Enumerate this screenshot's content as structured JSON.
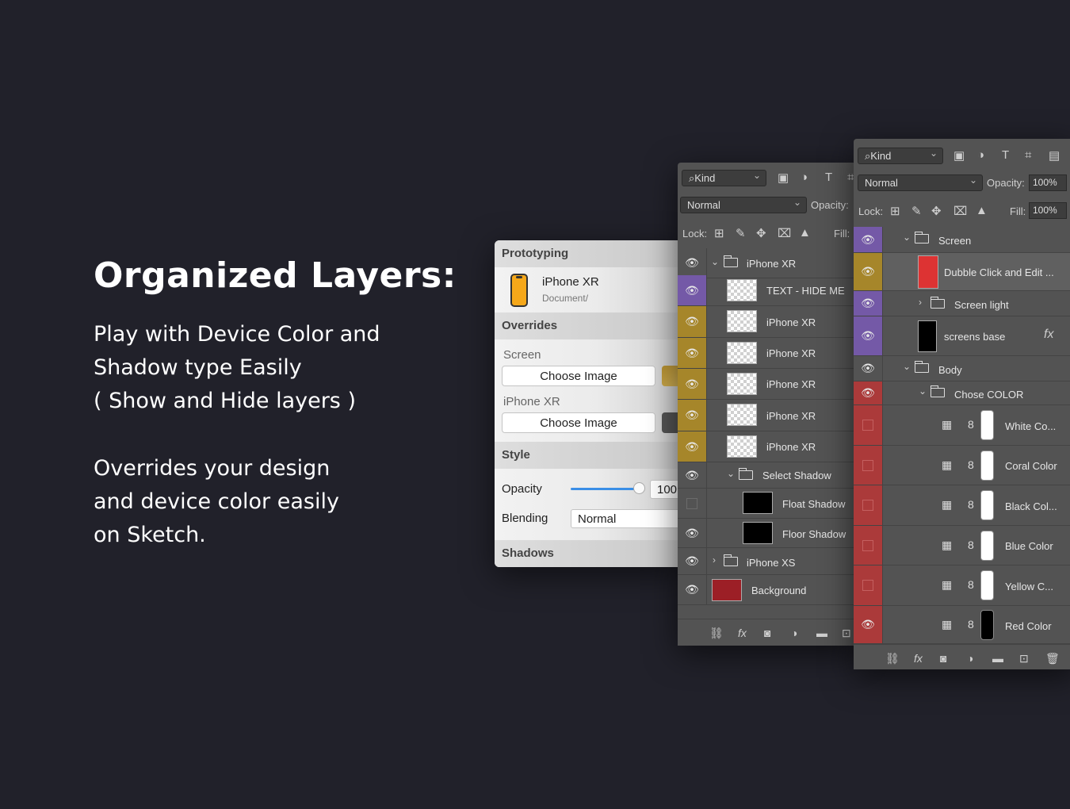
{
  "headline": "Organized Layers:",
  "paragraph1": [
    "Play with Device Color and",
    "Shadow type Easily",
    "( Show and Hide layers )"
  ],
  "paragraph2": [
    "Overrides your design",
    "and device color easily",
    "on Sketch."
  ],
  "sketch_panel": {
    "section_prototyping": "Prototyping",
    "symbol_name": "iPhone XR",
    "symbol_path": "Document/",
    "section_overrides": "Overrides",
    "screen_label": "Screen",
    "screen_button": "Choose Image",
    "iphone_label": "iPhone XR",
    "iphone_button": "Choose Image",
    "section_style": "Style",
    "opacity_label": "Opacity",
    "opacity_value": "100",
    "opacity_fraction": 1.0,
    "blending_label": "Blending",
    "blending_value": "Normal",
    "section_shadows": "Shadows",
    "colors": {
      "phone": "#f6a81a",
      "slider": "#3a8ee6"
    }
  },
  "ps_panel_1": {
    "kind_label": "Kind",
    "blend_mode": "Normal",
    "opacity_label": "Opacity:",
    "lock_label": "Lock:",
    "fill_label": "Fill:",
    "layers": [
      {
        "name": "iPhone XR",
        "type": "group",
        "expanded": true,
        "eye": "visible",
        "color": "none"
      },
      {
        "name": "TEXT - HIDE ME",
        "type": "layer",
        "eye": "visible",
        "color": "purple"
      },
      {
        "name": "iPhone XR",
        "type": "layer",
        "eye": "visible",
        "color": "gold"
      },
      {
        "name": "iPhone XR",
        "type": "layer",
        "eye": "visible",
        "color": "gold"
      },
      {
        "name": "iPhone XR",
        "type": "layer",
        "eye": "visible",
        "color": "gold"
      },
      {
        "name": "iPhone XR",
        "type": "layer",
        "eye": "visible",
        "color": "gold"
      },
      {
        "name": "iPhone XR",
        "type": "layer",
        "eye": "visible",
        "color": "gold"
      },
      {
        "name": "Select Shadow",
        "type": "group",
        "expanded": true,
        "eye": "visible",
        "color": "none"
      },
      {
        "name": "Float Shadow",
        "type": "layer",
        "eye": "hidden",
        "color": "none"
      },
      {
        "name": "Floor Shadow",
        "type": "layer",
        "eye": "visible",
        "color": "none"
      },
      {
        "name": "iPhone XS",
        "type": "group",
        "expanded": false,
        "eye": "visible",
        "color": "none"
      },
      {
        "name": "Background",
        "type": "layer",
        "eye": "visible",
        "color": "none"
      }
    ]
  },
  "ps_panel_2": {
    "kind_label": "Kind",
    "blend_mode": "Normal",
    "opacity_label": "Opacity:",
    "opacity_value": "100%",
    "lock_label": "Lock:",
    "fill_label": "Fill:",
    "fill_value": "100%",
    "fx_label": "fx",
    "layers": [
      {
        "name": "Screen",
        "type": "group",
        "expanded": true,
        "eye": "visible",
        "color": "purple"
      },
      {
        "name": "Dubble Click and Edit ...",
        "type": "layer",
        "eye": "visible",
        "color": "gold"
      },
      {
        "name": "Screen light",
        "type": "group",
        "expanded": false,
        "eye": "visible",
        "color": "purple"
      },
      {
        "name": "screens base",
        "type": "layer",
        "eye": "visible",
        "color": "purple"
      },
      {
        "name": "Body",
        "type": "group",
        "expanded": true,
        "eye": "visible",
        "color": "none"
      },
      {
        "name": "Chose COLOR",
        "type": "group",
        "expanded": true,
        "eye": "visible",
        "color": "red"
      },
      {
        "name": "White Co...",
        "type": "fill",
        "eye": "hidden",
        "color": "red"
      },
      {
        "name": "Coral Color",
        "type": "fill",
        "eye": "hidden",
        "color": "red"
      },
      {
        "name": "Black Col...",
        "type": "fill",
        "eye": "hidden",
        "color": "red"
      },
      {
        "name": "Blue Color",
        "type": "fill",
        "eye": "hidden",
        "color": "red"
      },
      {
        "name": "Yellow C...",
        "type": "fill",
        "eye": "hidden",
        "color": "red"
      },
      {
        "name": "Red Color",
        "type": "fill",
        "eye": "visible",
        "color": "red"
      }
    ]
  }
}
